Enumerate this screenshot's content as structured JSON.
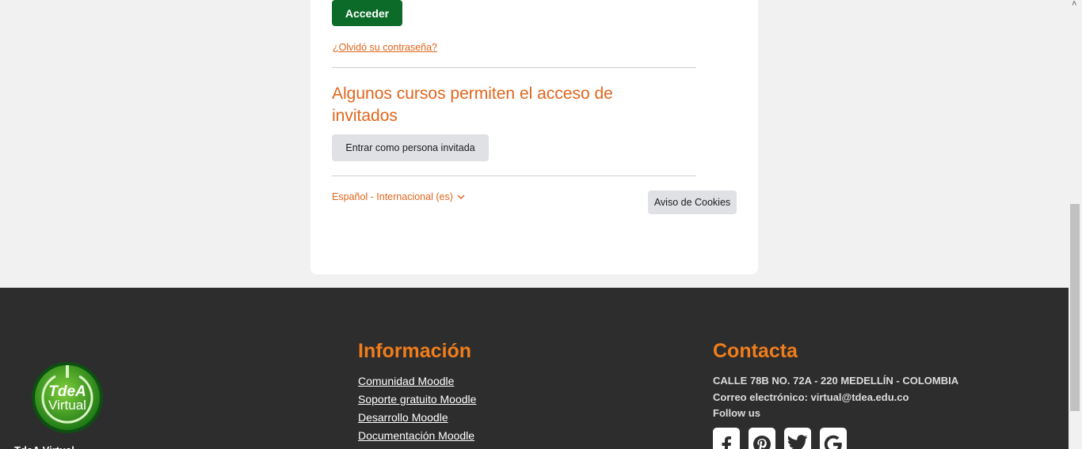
{
  "login": {
    "submit_label": "Acceder",
    "forgot_password": "¿Olvidó su contraseña?"
  },
  "guest": {
    "heading": "Algunos cursos permiten el acceso de invitados",
    "button_label": "Entrar como persona invitada"
  },
  "language": {
    "selected": "Español - Internacional (es)",
    "icon": "chevron-down-icon"
  },
  "cookies": {
    "button_label": "Aviso de Cookies"
  },
  "footer": {
    "logo_text_top": "TdeA",
    "logo_text_bottom": "Virtual",
    "information": {
      "title": "Información",
      "links": [
        "Comunidad Moodle",
        "Soporte gratuito Moodle",
        "Desarrollo Moodle",
        "Documentación Moodle"
      ]
    },
    "contact": {
      "title": "Contacta",
      "address": "CALLE 78B NO. 72A - 220 MEDELLÍN - COLOMBIA",
      "email": "Correo electrónico: virtual@tdea.edu.co",
      "follow": "Follow us",
      "social_icons": [
        "facebook-icon",
        "pinterest-icon",
        "twitter-icon",
        "google-icon"
      ]
    }
  },
  "colors": {
    "accent_orange": "#e0651b",
    "footer_title_orange": "#f07d1b",
    "primary_green": "#0d6b2a",
    "footer_bg": "#2d2d2d"
  }
}
